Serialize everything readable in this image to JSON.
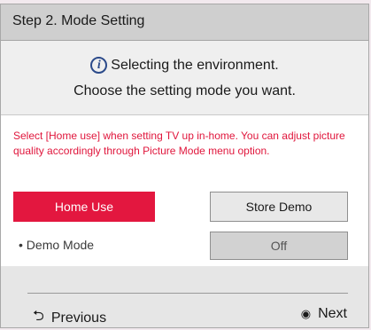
{
  "header": {
    "title": "Step 2. Mode Setting"
  },
  "intro": {
    "icon": "info-icon",
    "icon_glyph": "i",
    "line1": "Selecting the environment.",
    "line2": "Choose the setting mode you want."
  },
  "description": "Select [Home use] when setting TV up in-home. You can adjust picture quality accordingly through Picture Mode menu option.",
  "options": {
    "home_use": "Home Use",
    "store_demo": "Store Demo",
    "selected": "Home Use"
  },
  "demo_mode": {
    "label": "• Demo Mode",
    "value": "Off"
  },
  "footer": {
    "previous_label": "Previous",
    "previous_icon": "return-arrow-icon",
    "next_label": "Next",
    "next_icon": "ok-button-icon"
  },
  "colors": {
    "accent": "#e3173f",
    "header_bg": "#cfcfcf",
    "info_icon": "#2b4a8a"
  }
}
